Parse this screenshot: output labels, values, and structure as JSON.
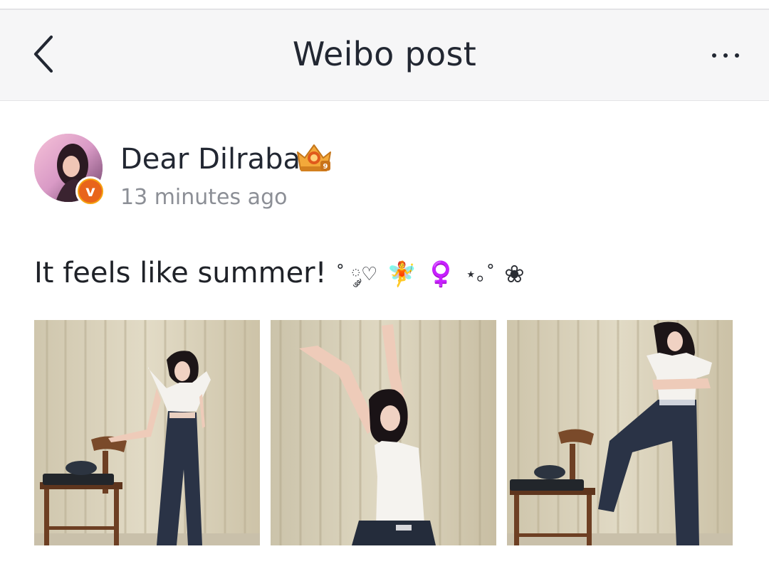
{
  "navbar": {
    "title": "Weibo post",
    "back_icon": "chevron-left-icon",
    "more_icon": "more-horizontal-icon"
  },
  "post": {
    "author": {
      "name": "Dear Dilraba",
      "verified_icon": "verified-v-icon",
      "rank_icon": "crown-rank-icon"
    },
    "timestamp": "13 minutes ago",
    "text": {
      "main": "It feels like summer!",
      "deco1": "˚ ༘♡",
      "emoji1": "🧚",
      "emoji2": "♀️",
      "deco2": "⋆｡˚",
      "deco3": "❀"
    },
    "photos": [
      {
        "name": "photo-1",
        "description_icon": "photo-standing-with-chair"
      },
      {
        "name": "photo-2",
        "description_icon": "photo-arms-raised"
      },
      {
        "name": "photo-3",
        "description_icon": "photo-leg-on-chair"
      }
    ]
  },
  "colors": {
    "navbar_bg": "#f6f6f7",
    "text_primary": "#222732",
    "text_secondary": "#8c8f96",
    "verified_orange": "#f5a10f"
  }
}
